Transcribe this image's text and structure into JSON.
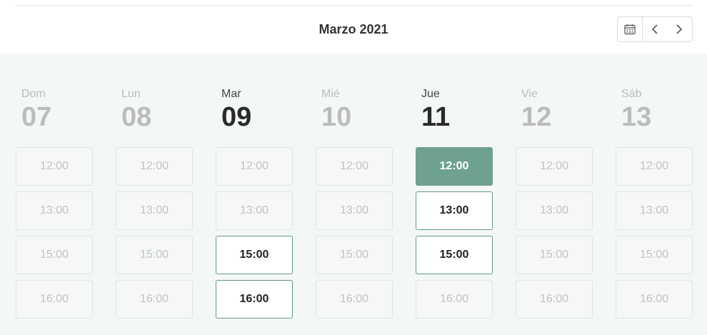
{
  "header": {
    "month_title": "Marzo 2021"
  },
  "icons": {
    "calendar": "calendar-icon",
    "prev": "chevron-left-icon",
    "next": "chevron-right-icon"
  },
  "colors": {
    "selected": "#6ea192",
    "available_border": "#5f9888",
    "disabled_text": "#c2c2c2"
  },
  "days": [
    {
      "dow": "Dom",
      "num": "07",
      "active": false,
      "slots": [
        {
          "time": "12:00",
          "state": "disabled"
        },
        {
          "time": "13:00",
          "state": "disabled"
        },
        {
          "time": "15:00",
          "state": "disabled"
        },
        {
          "time": "16:00",
          "state": "disabled"
        }
      ]
    },
    {
      "dow": "Lun",
      "num": "08",
      "active": false,
      "slots": [
        {
          "time": "12:00",
          "state": "disabled"
        },
        {
          "time": "13:00",
          "state": "disabled"
        },
        {
          "time": "15:00",
          "state": "disabled"
        },
        {
          "time": "16:00",
          "state": "disabled"
        }
      ]
    },
    {
      "dow": "Mar",
      "num": "09",
      "active": true,
      "slots": [
        {
          "time": "12:00",
          "state": "disabled"
        },
        {
          "time": "13:00",
          "state": "disabled"
        },
        {
          "time": "15:00",
          "state": "available"
        },
        {
          "time": "16:00",
          "state": "available"
        }
      ]
    },
    {
      "dow": "Mié",
      "num": "10",
      "active": false,
      "slots": [
        {
          "time": "12:00",
          "state": "disabled"
        },
        {
          "time": "13:00",
          "state": "disabled"
        },
        {
          "time": "15:00",
          "state": "disabled"
        },
        {
          "time": "16:00",
          "state": "disabled"
        }
      ]
    },
    {
      "dow": "Jue",
      "num": "11",
      "active": true,
      "slots": [
        {
          "time": "12:00",
          "state": "selected"
        },
        {
          "time": "13:00",
          "state": "available"
        },
        {
          "time": "15:00",
          "state": "available"
        },
        {
          "time": "16:00",
          "state": "disabled"
        }
      ]
    },
    {
      "dow": "Vie",
      "num": "12",
      "active": false,
      "slots": [
        {
          "time": "12:00",
          "state": "disabled"
        },
        {
          "time": "13:00",
          "state": "disabled"
        },
        {
          "time": "15:00",
          "state": "disabled"
        },
        {
          "time": "16:00",
          "state": "disabled"
        }
      ]
    },
    {
      "dow": "Sáb",
      "num": "13",
      "active": false,
      "slots": [
        {
          "time": "12:00",
          "state": "disabled"
        },
        {
          "time": "13:00",
          "state": "disabled"
        },
        {
          "time": "15:00",
          "state": "disabled"
        },
        {
          "time": "16:00",
          "state": "disabled"
        }
      ]
    }
  ]
}
